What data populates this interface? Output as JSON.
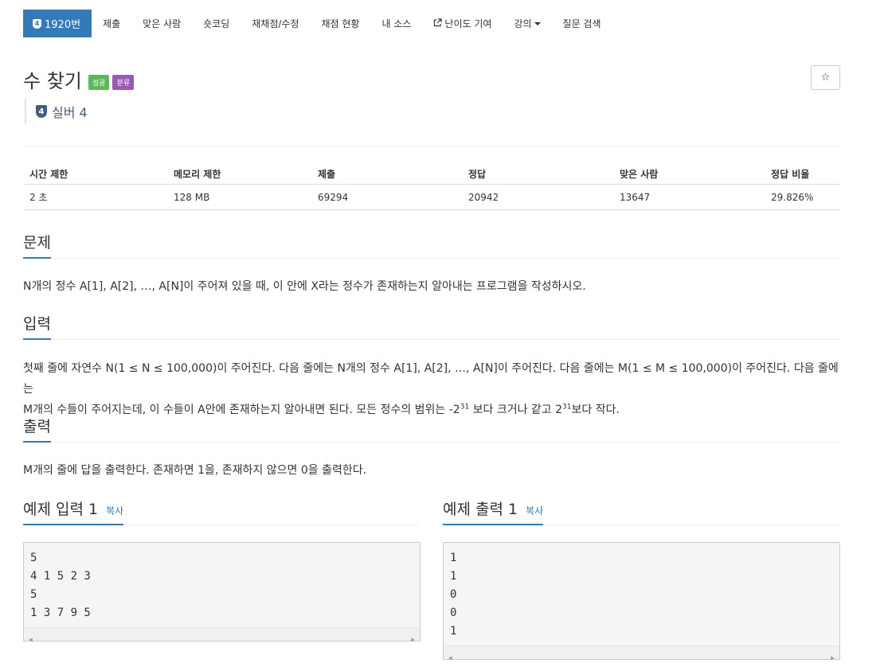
{
  "nav": {
    "problem_badge": "4",
    "problem_number": "1920번",
    "items": [
      "제출",
      "맞은 사람",
      "숏코딩",
      "재채점/수정",
      "채점 현황",
      "내 소스",
      "난이도 기여",
      "강의",
      "질문 검색"
    ],
    "accent": "#337ab7"
  },
  "problem": {
    "title": "수 찾기",
    "label_success": "성공",
    "label_tag": "분류",
    "star": "☆",
    "tier_num": "4",
    "tier_text": "실버 4"
  },
  "stats": {
    "headers": [
      "시간 제한",
      "메모리 제한",
      "제출",
      "정답",
      "맞은 사람",
      "정답 비율"
    ],
    "values": [
      "2 초",
      "128 MB",
      "69294",
      "20942",
      "13647",
      "29.826%"
    ]
  },
  "sections": {
    "problem_head": "문제",
    "problem_text": "N개의 정수 A[1], A[2], …, A[N]이 주어져 있을 때, 이 안에 X라는 정수가 존재하는지 알아내는 프로그램을 작성하시오.",
    "input_head": "입력",
    "input_text_1": "첫째 줄에 자연수 N(1 ≤ N ≤ 100,000)이 주어진다. 다음 줄에는 N개의 정수 A[1], A[2], …, A[N]이 주어진다. 다음 줄에는 M(1 ≤ M ≤ 100,000)이 주어진다. 다음 줄에는",
    "input_text_2a": "M개의 수들이 주어지는데, 이 수들이 A안에 존재하는지 알아내면 된다. 모든 정수의 범위는 -2",
    "input_sup_1": "31",
    "input_text_2b": " 보다 크거나 같고 2",
    "input_sup_2": "31",
    "input_text_2c": "보다 작다.",
    "output_head": "출력",
    "output_text": "M개의 줄에 답을 출력한다. 존재하면 1을, 존재하지 않으면 0을 출력한다."
  },
  "examples": {
    "input_head": "예제 입력 1",
    "output_head": "예제 출력 1",
    "copy_label": "복사",
    "input_text": "5\n4 1 5 2 3\n5\n1 3 7 9 5",
    "output_text": "1\n1\n0\n0\n1"
  }
}
